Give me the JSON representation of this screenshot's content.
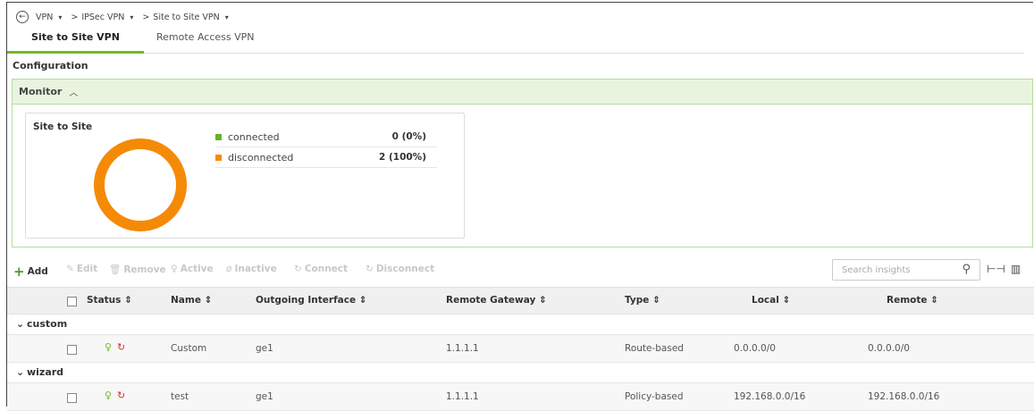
{
  "breadcrumb": {
    "back_icon": "back-arrow-icon",
    "items": [
      {
        "label": "VPN",
        "caret": "▾"
      },
      {
        "label": "IPSec VPN",
        "caret": "▾"
      },
      {
        "label": "Site to Site VPN",
        "caret": "▾"
      }
    ],
    "separator": ">"
  },
  "tabs": [
    {
      "label": "Site to Site VPN",
      "active": true
    },
    {
      "label": "Remote Access VPN",
      "active": false
    }
  ],
  "section_label": "Configuration",
  "monitor": {
    "title": "Monitor",
    "card_title": "Site to Site",
    "legend": [
      {
        "label": "connected",
        "value": "0 (0%)",
        "color": "#5fb526"
      },
      {
        "label": "disconnected",
        "value": "2 (100%)",
        "color": "#f58a07"
      }
    ]
  },
  "toolbar": {
    "add": "Add",
    "edit": "Edit",
    "remove": "Remove",
    "active": "Active",
    "inactive": "Inactive",
    "connect": "Connect",
    "disconnect": "Disconnect",
    "search_placeholder": "Search insights"
  },
  "table": {
    "columns": [
      "Status",
      "Name",
      "Outgoing Interface",
      "Remote Gateway",
      "Type",
      "Local",
      "Remote"
    ],
    "sort_icon": "⇕",
    "groups": [
      {
        "label": "custom",
        "rows": [
          {
            "name": "Custom",
            "interface": "ge1",
            "gateway": "1.1.1.1",
            "type": "Route-based",
            "local": "0.0.0.0/0",
            "remote": "0.0.0.0/0"
          }
        ]
      },
      {
        "label": "wizard",
        "rows": [
          {
            "name": "test",
            "interface": "ge1",
            "gateway": "1.1.1.1",
            "type": "Policy-based",
            "local": "192.168.0.0/16",
            "remote": "192.168.0.0/16"
          }
        ]
      }
    ]
  },
  "colors": {
    "accent": "#76b82a",
    "monitor_bg": "#e9f4df",
    "disconnected": "#f58a07",
    "connected": "#5fb526"
  }
}
